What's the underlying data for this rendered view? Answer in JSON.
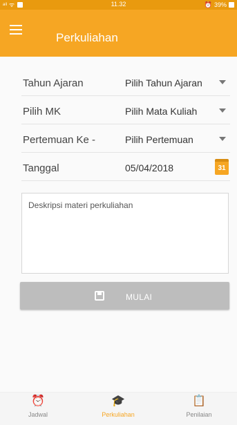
{
  "status_bar": {
    "left_text": "ᵃⁱˡ ᯤ",
    "time": "11.32",
    "battery": "39%",
    "alarm_glyph": "⏰"
  },
  "app_bar": {
    "title": "Perkuliahan"
  },
  "form": {
    "rows": [
      {
        "label": "Tahun Ajaran",
        "value": "Pilih Tahun Ajaran"
      },
      {
        "label": "Pilih MK",
        "value": "Pilih Mata Kuliah"
      },
      {
        "label": "Pertemuan Ke -",
        "value": "Pilih Pertemuan"
      },
      {
        "label": "Tanggal",
        "value": "05/04/2018",
        "calendar_day": "31"
      }
    ],
    "description_placeholder": "Deskripsi materi perkuliahan"
  },
  "start_button": {
    "label": "MULAI"
  },
  "bottom_nav": {
    "items": [
      {
        "label": "Jadwal",
        "icon": "alarm-clock-icon",
        "glyph": "⏰"
      },
      {
        "label": "Perkuliahan",
        "icon": "graduation-cap-icon",
        "glyph": "🎓",
        "active": true
      },
      {
        "label": "Penilaian",
        "icon": "clipboard-icon",
        "glyph": "📋"
      }
    ]
  },
  "colors": {
    "accent": "#f6a623",
    "status_bar": "#e99a0f",
    "disabled_button": "#bdbdbd"
  }
}
